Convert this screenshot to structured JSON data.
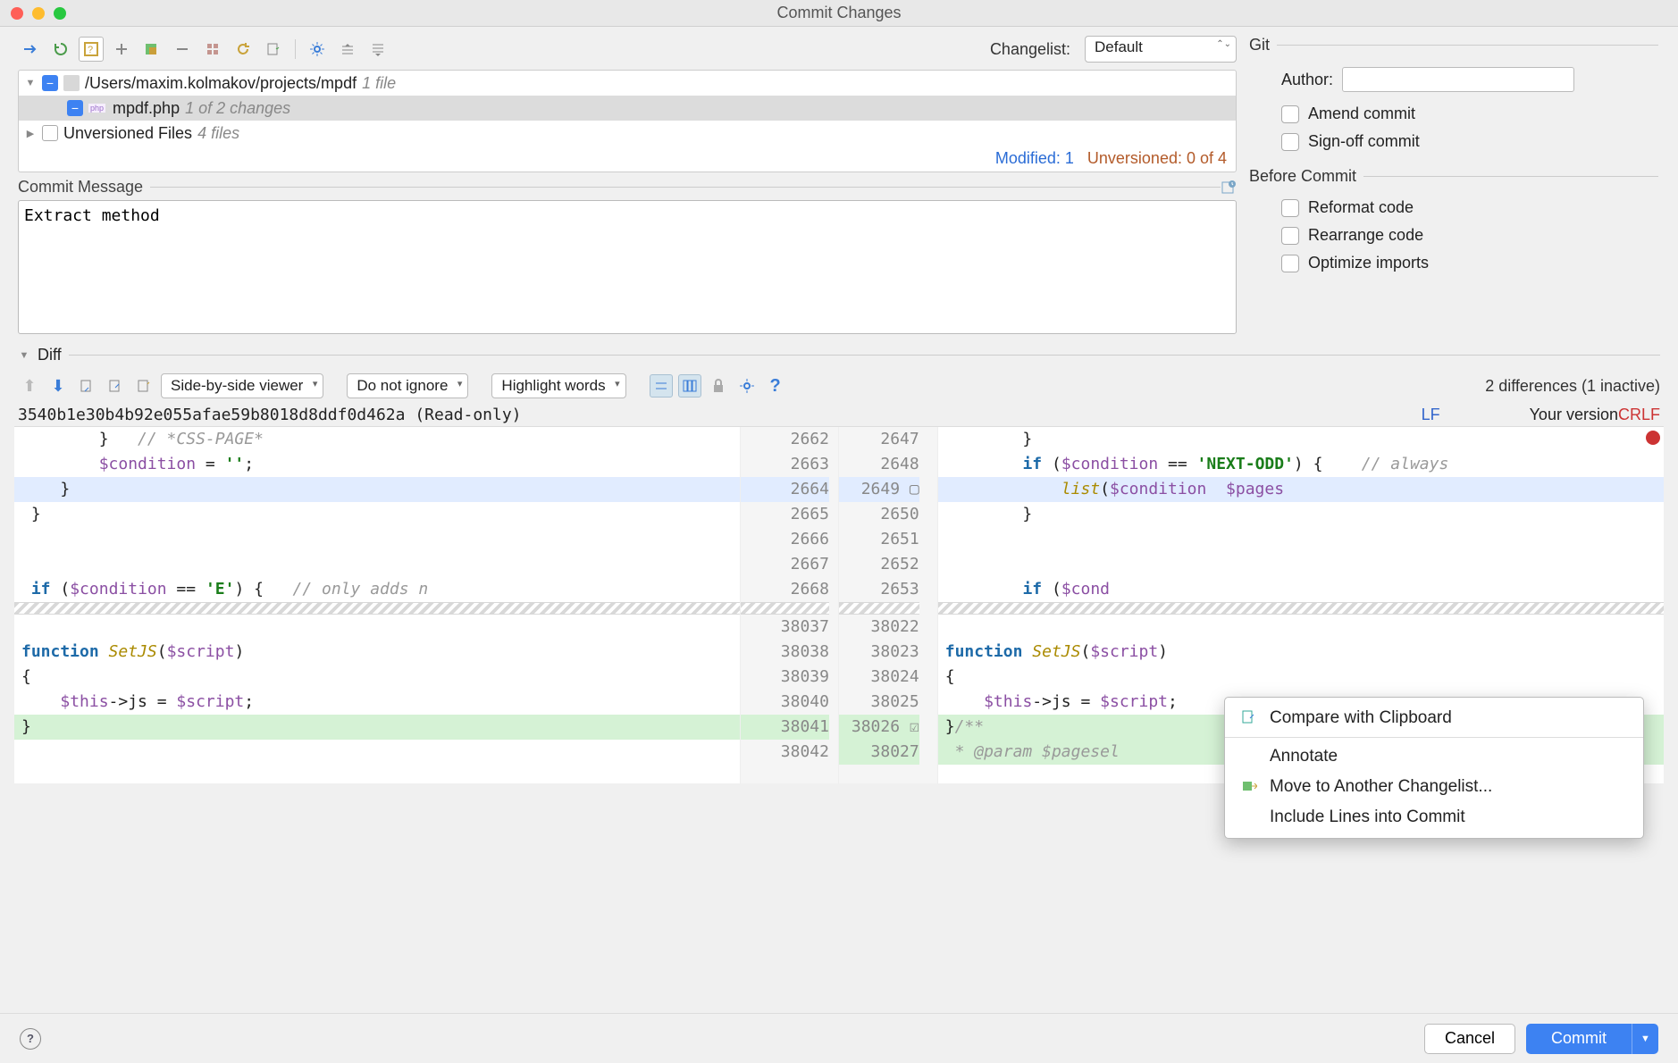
{
  "window": {
    "title": "Commit Changes"
  },
  "toolbar": {
    "changelist_label": "Changelist:",
    "changelist_value": "Default"
  },
  "tree": {
    "root_path": "/Users/maxim.kolmakov/projects/mpdf",
    "root_meta": "1 file",
    "items": [
      {
        "name": "mpdf.php",
        "meta": "1 of 2 changes",
        "checked": true
      }
    ],
    "unversioned_label": "Unversioned Files",
    "unversioned_meta": "4 files"
  },
  "status": {
    "modified_label": "Modified: 1",
    "unversioned_label": "Unversioned: 0 of 4"
  },
  "commit_msg": {
    "label": "Commit Message",
    "value": "Extract method"
  },
  "git": {
    "section": "Git",
    "author_label": "Author:",
    "author_value": "",
    "amend_label": "Amend commit",
    "signoff_label": "Sign-off commit"
  },
  "before": {
    "section": "Before Commit",
    "reformat": "Reformat code",
    "rearrange": "Rearrange code",
    "optimize": "Optimize imports"
  },
  "diff": {
    "section": "Diff",
    "viewer": "Side-by-side viewer",
    "ignore": "Do not ignore",
    "highlight": "Highlight words",
    "count": "2 differences (1 inactive)",
    "left_title": "3540b1e30b4b92e055afae59b8018d8ddf0d462a (Read-only)",
    "left_enc": "LF",
    "right_title": "Your version",
    "right_enc": "CRLF",
    "left_lines": [
      "2662",
      "2663",
      "2664",
      "2665",
      "2666",
      "2667",
      "2668",
      "38037",
      "38038",
      "38039",
      "38040",
      "38041",
      "38042"
    ],
    "right_lines": [
      "2647",
      "2648",
      "2649",
      "2650",
      "2651",
      "2652",
      "2653",
      "38022",
      "38023",
      "38024",
      "38025",
      "38026",
      "38027"
    ],
    "left_code": [
      "        }   // *CSS-PAGE*",
      "        $condition = '';",
      "    }",
      " }",
      "",
      "",
      " if ($condition == 'E') {   // only adds n",
      "",
      "function SetJS($script)",
      "{",
      "    $this->js = $script;",
      "}",
      ""
    ],
    "right_code": [
      "        }",
      "        if ($condition == 'NEXT-ODD') {    // always",
      "            list($condition  $pages",
      "        }",
      "",
      "",
      "        if ($cond",
      "",
      "function SetJS($script)",
      "{",
      "    $this->js = $script;",
      "}/**",
      " * @param $pagesel"
    ]
  },
  "context_menu": {
    "items": [
      "Compare with Clipboard",
      "Annotate",
      "Move to Another Changelist...",
      "Include Lines into Commit"
    ]
  },
  "buttons": {
    "cancel": "Cancel",
    "commit": "Commit"
  }
}
